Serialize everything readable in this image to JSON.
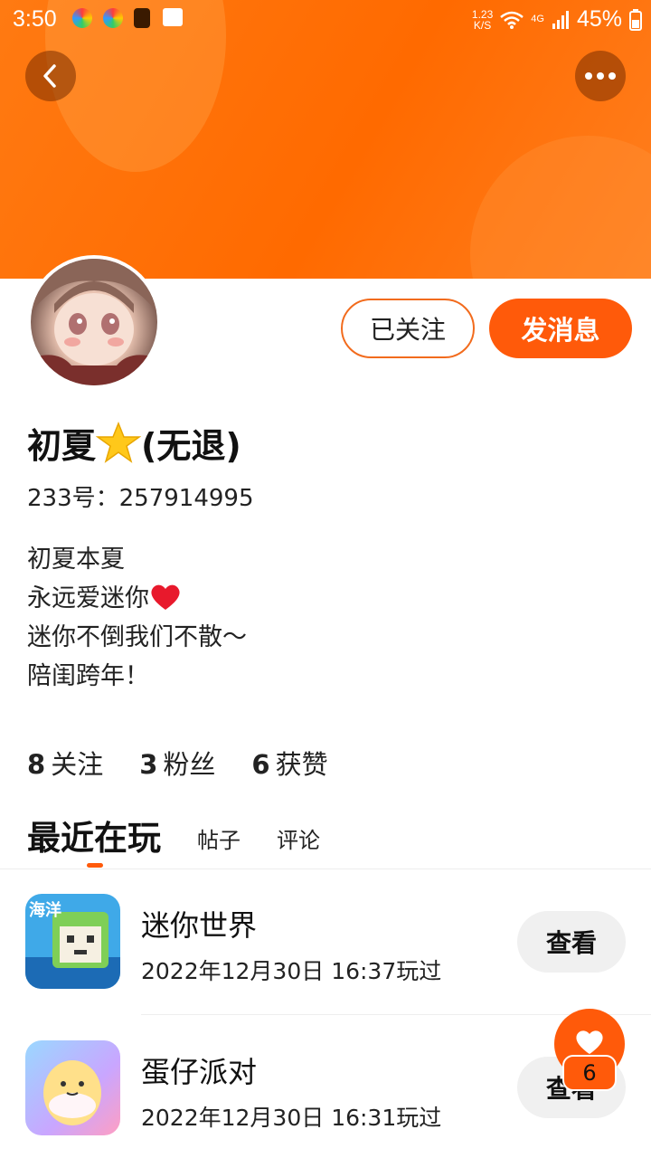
{
  "status_bar": {
    "time": "3:50",
    "speed_value": "1.23",
    "speed_unit": "K/S",
    "network": "4G",
    "battery": "45%"
  },
  "icons": {
    "back": "back-arrow-icon",
    "more": "more-dots-icon",
    "fab": "heart-icon"
  },
  "profile": {
    "follow_label": "已关注",
    "message_label": "发消息",
    "nickname_prefix": "初夏",
    "nickname_suffix": "(无退)",
    "uid_label": "233号：",
    "uid_value": "257914995",
    "bio": [
      "初夏本夏",
      "永远爱迷你",
      "迷你不倒我们不散～",
      "陪闺跨年！"
    ]
  },
  "stats": [
    {
      "num": "8",
      "label": "关注"
    },
    {
      "num": "3",
      "label": "粉丝"
    },
    {
      "num": "6",
      "label": "获赞"
    }
  ],
  "tabs": {
    "active": "最近在玩",
    "posts": "帖子",
    "comments": "评论"
  },
  "games": [
    {
      "name": "迷你世界",
      "time": "2022年12月30日 16:37玩过",
      "button": "查看",
      "icon_text": "海洋"
    },
    {
      "name": "蛋仔派对",
      "time": "2022年12月30日 16:31玩过",
      "button": "查看"
    }
  ],
  "fab": {
    "count": "6"
  },
  "colors": {
    "accent": "#ff5a0a",
    "banner": "#ff7010"
  }
}
